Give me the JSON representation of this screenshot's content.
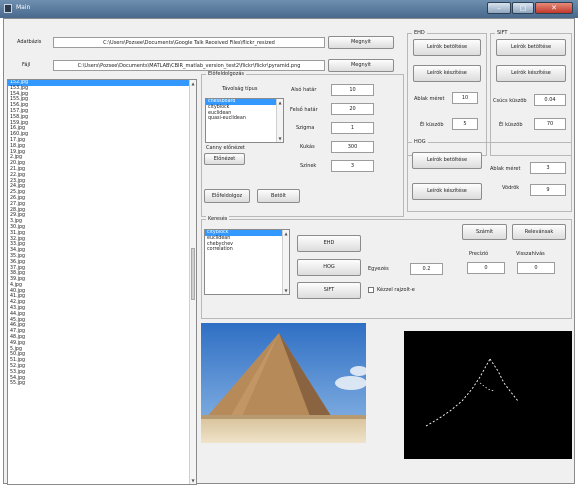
{
  "window": {
    "title": "Main"
  },
  "paths": {
    "dir_label": "Adatbázis",
    "dir_value": "C:\\Users\\Pozsee\\Documents\\Google Talk Received Files\\flickr_resized",
    "dir_open": "Megnyit",
    "file_label": "Fájl",
    "file_value": "C:\\Users\\Pozsee\\Documents\\MATLAB\\CBIR_matlab_version_test2\\flickr\\flickr\\pyramid.png",
    "file_open": "Megnyit"
  },
  "file_list": {
    "items": [
      "152.jpg",
      "153.jpg",
      "154.jpg",
      "155.jpg",
      "156.jpg",
      "157.jpg",
      "158.jpg",
      "159.jpg",
      "16.jpg",
      "160.jpg",
      "17.jpg",
      "18.jpg",
      "19.jpg",
      "2.jpg",
      "20.jpg",
      "21.jpg",
      "22.jpg",
      "23.jpg",
      "24.jpg",
      "25.jpg",
      "26.jpg",
      "27.jpg",
      "28.jpg",
      "29.jpg",
      "3.jpg",
      "30.jpg",
      "31.jpg",
      "32.jpg",
      "33.jpg",
      "34.jpg",
      "35.jpg",
      "36.jpg",
      "37.jpg",
      "38.jpg",
      "39.jpg",
      "4.jpg",
      "40.jpg",
      "41.jpg",
      "42.jpg",
      "43.jpg",
      "44.jpg",
      "45.jpg",
      "46.jpg",
      "47.jpg",
      "48.jpg",
      "49.jpg",
      "5.jpg",
      "50.jpg",
      "51.jpg",
      "52.jpg",
      "53.jpg",
      "54.jpg",
      "55.jpg"
    ],
    "selected_index": 0
  },
  "preproc": {
    "title": "Előfeldolgozás",
    "distance_type_label": "Távolság típus",
    "distance_options": [
      "chessboard",
      "cityblock",
      "euclidean",
      "quasi-euclidean"
    ],
    "distance_selected": 0,
    "lower_thr_label": "Alsó határ",
    "lower_thr_value": "10",
    "upper_thr_label": "Felső határ",
    "upper_thr_value": "20",
    "sigma_label": "Szigma",
    "sigma_value": "1",
    "canny_label": "Canny előnézet",
    "preview_button": "Előnézet",
    "kernel_label": "Kukás",
    "kernel_value": "300",
    "color_label": "Színek",
    "color_value": "3",
    "preprocess_button": "Előfeldolgoz",
    "load_button": "Betölt"
  },
  "ehd": {
    "title": "EHD",
    "load_button": "Leírók betöltése",
    "create_button": "Leírók készítése",
    "block_label": "Ablak méret",
    "block_value": "10",
    "edge_label": "Él küszöb",
    "edge_value": "5"
  },
  "sift": {
    "title": "SIFT",
    "load_button": "Leírók betöltése",
    "create_button": "Leírók készítése",
    "peak_label": "Csúcs küszöb",
    "peak_value": "0.04",
    "edge_label": "Él küszöb",
    "edge_value": "70"
  },
  "hog": {
    "title": "HOG",
    "load_button": "Leírók betöltése",
    "create_button": "Leírók készítése",
    "block_label": "Ablak méret",
    "block_value": "3",
    "bins_label": "Vödrök",
    "bins_value": "9"
  },
  "search": {
    "title": "Keresés",
    "metric_options": [
      "cityblock",
      "euclidean",
      "chebychev",
      "correlation"
    ],
    "metric_selected": 0,
    "ehd_button": "EHD",
    "hog_button": "HOG",
    "sift_button": "SIFT",
    "compute_button": "Számít",
    "relevance_button": "Relevánsak",
    "precision_label": "Precízió",
    "precision_value": "0",
    "recall_label": "Visszahívás",
    "recall_value": "0",
    "match_label": "Egyezés",
    "match_value": "0.2",
    "sketch_label": "Kézzel rajzolt-e"
  },
  "images": {
    "query_photo_icon": "pyramid-photo",
    "edge_map_icon": "edge-map"
  }
}
